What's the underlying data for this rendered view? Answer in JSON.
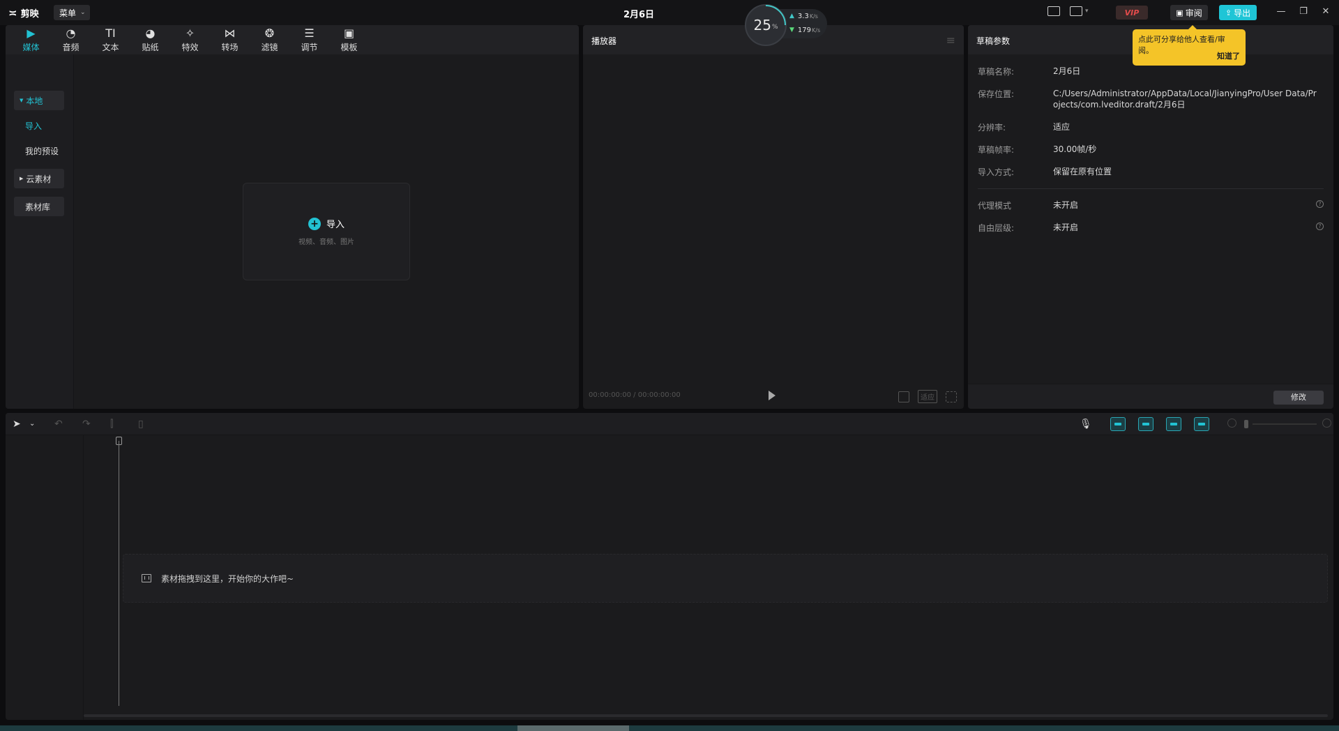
{
  "app": {
    "logo_text": "剪映",
    "menu_label": "菜单",
    "doc_title": "2月6日"
  },
  "perf": {
    "cpu_value": "25",
    "cpu_unit": "%",
    "upload_speed": "3.3",
    "upload_unit": "K/s",
    "download_speed": "179",
    "download_unit": "K/s"
  },
  "titlebar": {
    "vip_label": "VIP",
    "review_label": "审阅",
    "export_label": "导出",
    "accent_color": "#1fc5d6"
  },
  "tooltip": {
    "text": "点此可分享给他人查看/审阅。",
    "ok_label": "知道了"
  },
  "media": {
    "tabs": [
      {
        "label": "媒体",
        "icon": "media-icon"
      },
      {
        "label": "音频",
        "icon": "audio-icon"
      },
      {
        "label": "文本",
        "icon": "text-icon"
      },
      {
        "label": "贴纸",
        "icon": "sticker-icon"
      },
      {
        "label": "特效",
        "icon": "effects-icon"
      },
      {
        "label": "转场",
        "icon": "transition-icon"
      },
      {
        "label": "滤镜",
        "icon": "filter-icon"
      },
      {
        "label": "调节",
        "icon": "adjust-icon"
      },
      {
        "label": "模板",
        "icon": "template-icon"
      }
    ],
    "side": {
      "local": "本地",
      "import": "导入",
      "presets": "我的预设",
      "cloud": "云素材",
      "library": "素材库"
    },
    "import_card": {
      "label": "导入",
      "sub": "视频、音频、图片"
    }
  },
  "player": {
    "title": "播放器",
    "timecode": "00:00:00:00 / 00:00:00:00",
    "ratio_label": "适应"
  },
  "params": {
    "title": "草稿参数",
    "rows": [
      {
        "key": "草稿名称:",
        "value": "2月6日"
      },
      {
        "key": "保存位置:",
        "value": "C:/Users/Administrator/AppData/Local/JianyingPro/User Data/Projects/com.lveditor.draft/2月6日"
      },
      {
        "key": "分辨率:",
        "value": "适应"
      },
      {
        "key": "草稿帧率:",
        "value": "30.00帧/秒"
      },
      {
        "key": "导入方式:",
        "value": "保留在原有位置"
      },
      {
        "key": "代理模式",
        "value": "未开启"
      },
      {
        "key": "自由层级:",
        "value": "未开启"
      }
    ],
    "modify_label": "修改"
  },
  "timeline": {
    "drop_hint": "素材拖拽到这里，开始你的大作吧~"
  }
}
